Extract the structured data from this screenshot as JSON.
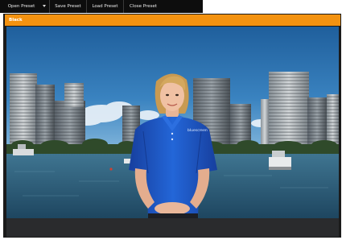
{
  "toolbar": {
    "open_preset": "Open Preset",
    "save_preset": "Save Preset",
    "load_preset": "Load Preset",
    "close_preset": "Close Preset"
  },
  "panel": {
    "title": "Black"
  },
  "polo_logo": "bluescreen",
  "colors": {
    "header_orange": "#f39210",
    "toolbar_bg": "#0d0d0d",
    "sky": "#2c6da8",
    "water": "#2d5b78",
    "shirt": "#1e56c9",
    "bottom_bar": "#2a2b2d"
  }
}
